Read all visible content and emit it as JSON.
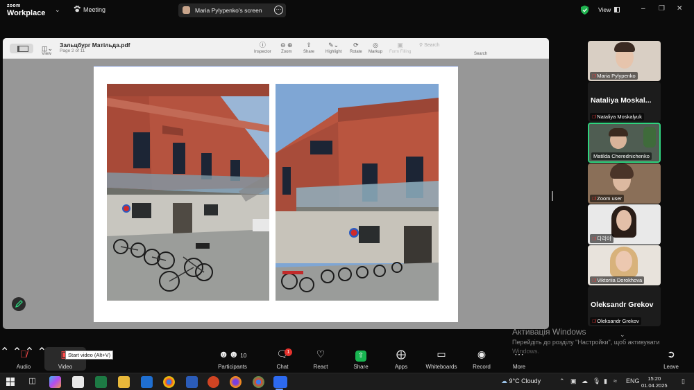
{
  "topbar": {
    "brand_small": "zoom",
    "brand_large": "Workplace",
    "meeting_label": "Meeting",
    "share_pill_label": "Maria Pylypenko's screen",
    "view_label": "View"
  },
  "preview": {
    "doc_title": "Зальцбург Матільда.pdf",
    "doc_subtitle": "Page 2 of 11",
    "view_label": "View",
    "tools": [
      "Inspector",
      "Zoom",
      "Share",
      "Highlight",
      "Rotate",
      "Markup",
      "Form Filling"
    ],
    "search_placeholder": "Search",
    "search_label": "Search"
  },
  "participants": [
    {
      "label": "Maria Pylypenko",
      "has_video": true
    },
    {
      "label": "Nataliya Moskalyuk",
      "display_name": "Nataliya  Moskal...",
      "has_video": false
    },
    {
      "label": "Matilda Cherednichenko",
      "has_video": true,
      "active": true
    },
    {
      "label": "Zoom user",
      "has_video": true
    },
    {
      "label": "다리아",
      "has_video": true
    },
    {
      "label": "Viktoriia Dorokhova",
      "has_video": true
    },
    {
      "label": "Oleksandr Grekov",
      "display_name": "Oleksandr Grekov",
      "has_video": false
    }
  ],
  "windows_activation": {
    "title": "Активація Windows",
    "line1": "Перейдіть до розділу \"Настройки\", щоб активувати",
    "line2": "Windows."
  },
  "controls": {
    "audio": "Audio",
    "video": "Video",
    "video_tooltip": "Start video (Alt+V)",
    "participants": "Participants",
    "participants_count": "10",
    "chat": "Chat",
    "chat_badge": "1",
    "react": "React",
    "share": "Share",
    "apps": "Apps",
    "whiteboards": "Whiteboards",
    "record": "Record",
    "more": "More",
    "leave": "Leave"
  },
  "taskbar": {
    "weather": "9°C  Cloudy",
    "language": "ENG",
    "time": "15:20",
    "date": "01.04.2025"
  },
  "colors": {
    "active_border": "#2fd37e",
    "share_green": "#18b551",
    "badge_red": "#e5322d",
    "building_red": "#b8503f"
  }
}
